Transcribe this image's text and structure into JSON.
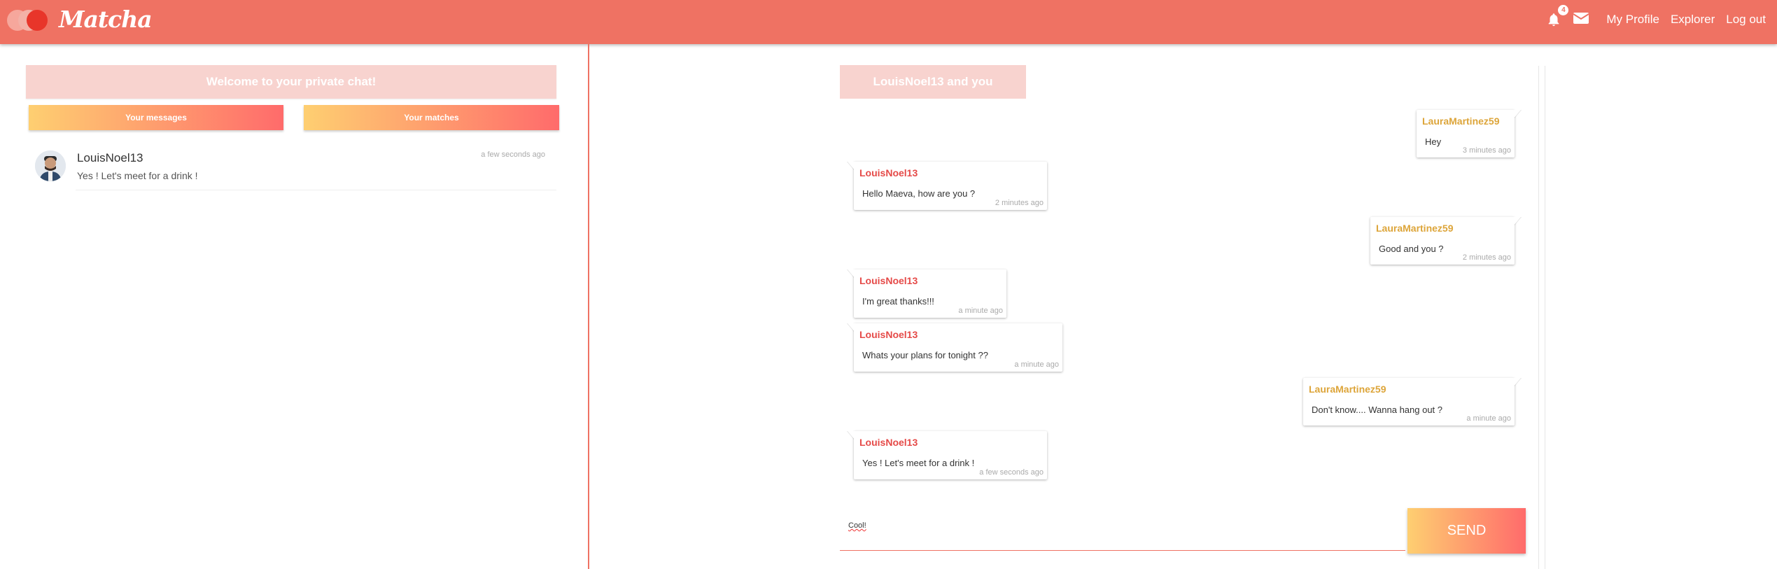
{
  "header": {
    "logo_text": "Matcha",
    "notification_count": "4",
    "nav": [
      "My Profile",
      "Explorer",
      "Log out"
    ],
    "bg_color": "#ef7263"
  },
  "left": {
    "welcome": "Welcome to your private chat!",
    "tabs": [
      "Your messages",
      "Your matches"
    ],
    "conversations": [
      {
        "name": "LouisNoel13",
        "preview": "Yes ! Let's meet for a drink !",
        "time": "a few seconds ago"
      }
    ]
  },
  "chat": {
    "title": "LouisNoel13 and you",
    "messages": [
      {
        "author": "LauraMartinez59",
        "text": "Hey",
        "time": "3 minutes ago",
        "side": "me"
      },
      {
        "author": "LouisNoel13",
        "text": "Hello Maeva, how are you ?",
        "time": "2 minutes ago",
        "side": "them"
      },
      {
        "author": "LauraMartinez59",
        "text": "Good and you ?",
        "time": "2 minutes ago",
        "side": "me"
      },
      {
        "author": "LouisNoel13",
        "text": "I'm great thanks!!!",
        "time": "a minute ago",
        "side": "them"
      },
      {
        "author": "LouisNoel13",
        "text": "Whats your plans for tonight ??",
        "time": "a minute ago",
        "side": "them"
      },
      {
        "author": "LauraMartinez59",
        "text": "Don't know.... Wanna hang out ?",
        "time": "a minute ago",
        "side": "me"
      },
      {
        "author": "LouisNoel13",
        "text": "Yes ! Let's meet for a drink !",
        "time": "a few seconds ago",
        "side": "them"
      }
    ],
    "input_value": "Cool!",
    "send_label": "SEND"
  }
}
